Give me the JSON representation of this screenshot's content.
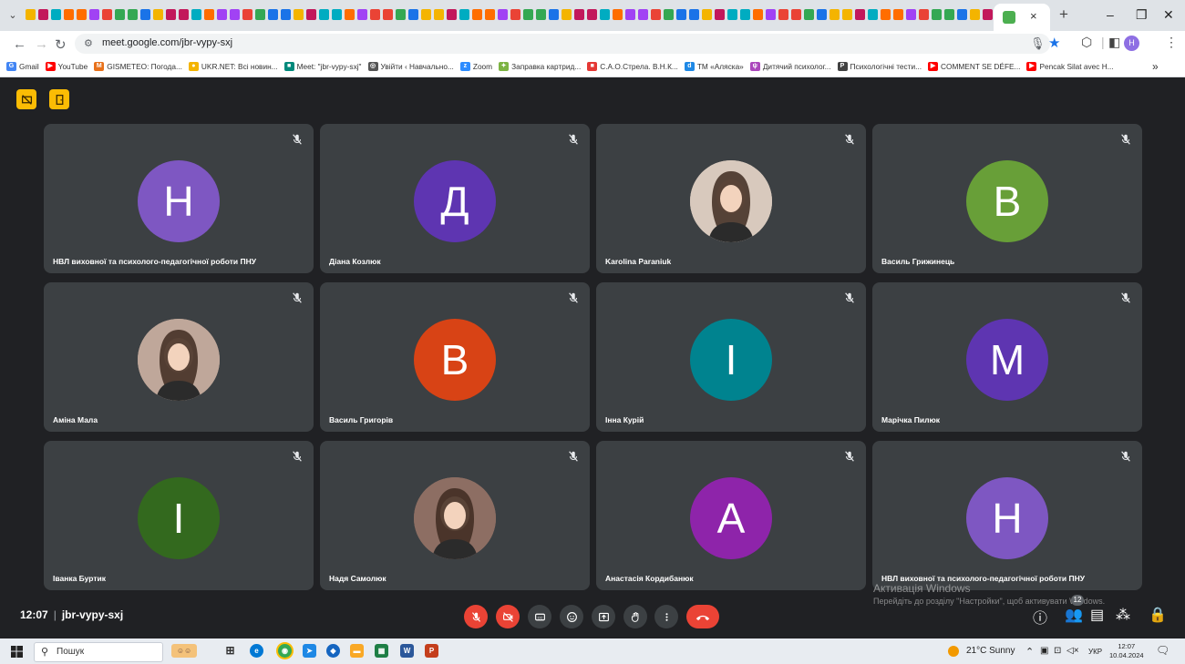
{
  "browser": {
    "url": "meet.google.com/jbr-vypy-sxj",
    "new_tab": "+",
    "close_tab": "×",
    "profile_initial": "H",
    "bookmarks": [
      {
        "label": "Gmail",
        "color": "#4285f4",
        "icon": "G"
      },
      {
        "label": "YouTube",
        "color": "#ff0000",
        "icon": "▶"
      },
      {
        "label": "GISMETEO: Погода...",
        "color": "#e8711a",
        "icon": "M"
      },
      {
        "label": "UKR.NET: Всі новин...",
        "color": "#f4b400",
        "icon": "●"
      },
      {
        "label": "Meet: \"jbr-vypy-sxj\"",
        "color": "#00897b",
        "icon": "■"
      },
      {
        "label": "Увійти ‹ Навчально...",
        "color": "#555555",
        "icon": "◎"
      },
      {
        "label": "Zoom",
        "color": "#2d8cff",
        "icon": "z"
      },
      {
        "label": "Заправка картрид...",
        "color": "#7cb342",
        "icon": "✦"
      },
      {
        "label": "С.А.О.Стрела. В.Н.К...",
        "color": "#e53935",
        "icon": "■"
      },
      {
        "label": "ТМ «Аляска»",
        "color": "#1e88e5",
        "icon": "d"
      },
      {
        "label": "Дитячий психолог...",
        "color": "#ab47bc",
        "icon": "ψ"
      },
      {
        "label": "Психологічні тести...",
        "color": "#424242",
        "icon": "P"
      },
      {
        "label": "COMMENT SE DÉFE...",
        "color": "#ff0000",
        "icon": "▶"
      },
      {
        "label": "Pencak Silat avec H...",
        "color": "#ff0000",
        "icon": "▶"
      }
    ],
    "bookmarks_more": "»"
  },
  "meeting": {
    "time": "12:07",
    "code": "jbr-vypy-sxj",
    "participants_count": "12",
    "participants": [
      {
        "name": "НВЛ виховної та психолого-педагогічної роботи ПНУ",
        "initial": "Н",
        "color": "#7e57c2"
      },
      {
        "name": "Діана Козлюк",
        "initial": "Д",
        "color": "#5e35b1"
      },
      {
        "name": "Karolina Paraniuk",
        "initial": "",
        "color": "#d8c9bd"
      },
      {
        "name": "Василь Грижинець",
        "initial": "В",
        "color": "#689f38"
      },
      {
        "name": "Аміна Мала",
        "initial": "",
        "color": "#bfa79a"
      },
      {
        "name": "Василь Григорів",
        "initial": "В",
        "color": "#d84315"
      },
      {
        "name": "Інна Курій",
        "initial": "І",
        "color": "#00838f"
      },
      {
        "name": "Марічка Пилюк",
        "initial": "М",
        "color": "#5e35b1"
      },
      {
        "name": "Іванка Буртик",
        "initial": "І",
        "color": "#33691e"
      },
      {
        "name": "Надя Самолюк",
        "initial": "",
        "color": "#8d6e63"
      },
      {
        "name": "Анастасія Кордибанюк",
        "initial": "А",
        "color": "#8e24aa"
      },
      {
        "name": "НВЛ виховної та психолого-педагогічної роботи ПНУ",
        "initial": "Н",
        "color": "#7e57c2"
      }
    ]
  },
  "watermark": {
    "title": "Активація Windows",
    "subtitle": "Перейдіть до розділу \"Настройки\", щоб активувати Windows."
  },
  "taskbar": {
    "search_placeholder": "Пошук",
    "weather": "21°C  Sunny",
    "lang": "УКР",
    "clock_time": "12:07",
    "clock_date": "10.04.2024"
  }
}
